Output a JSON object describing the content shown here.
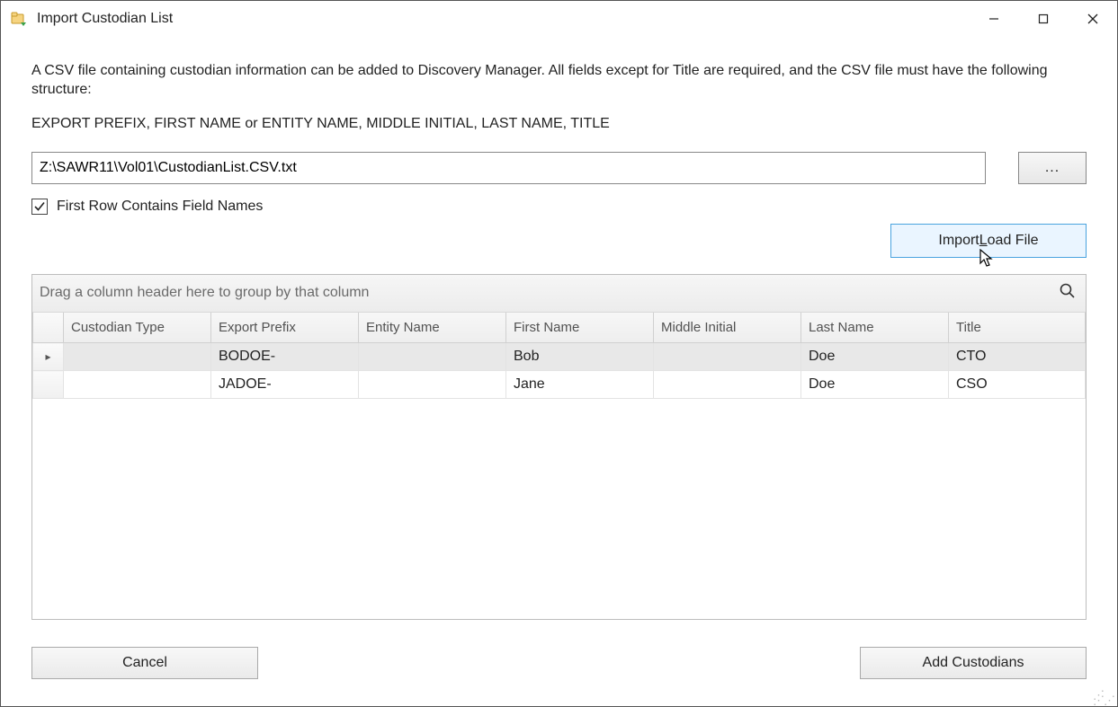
{
  "window": {
    "title": "Import Custodian List"
  },
  "intro": "A CSV file containing custodian information can be added to Discovery Manager. All fields except for Title are required, and the CSV file must have the following structure:",
  "structure_line": "EXPORT PREFIX, FIRST NAME or ENTITY NAME, MIDDLE INITIAL, LAST NAME, TITLE",
  "file_path": {
    "value": "Z:\\SAWR11\\Vol01\\CustodianList.CSV.txt",
    "browse_label": "..."
  },
  "first_row_checkbox": {
    "checked": true,
    "label": "First Row Contains Field Names"
  },
  "import_button": {
    "pre": "Import ",
    "underlined": "L",
    "post": "oad File"
  },
  "grid": {
    "group_hint": "Drag a column header here to group by that column",
    "columns": {
      "indicator": "",
      "custodian_type": "Custodian Type",
      "export_prefix": "Export Prefix",
      "entity_name": "Entity Name",
      "first_name": "First Name",
      "middle_initial": "Middle Initial",
      "last_name": "Last Name",
      "title": "Title"
    },
    "rows": [
      {
        "selected": true,
        "custodian_type": "",
        "export_prefix": "BODOE-",
        "entity_name": "",
        "first_name": "Bob",
        "middle_initial": "",
        "last_name": "Doe",
        "title": "CTO"
      },
      {
        "selected": false,
        "custodian_type": "",
        "export_prefix": "JADOE-",
        "entity_name": "",
        "first_name": "Jane",
        "middle_initial": "",
        "last_name": "Doe",
        "title": "CSO"
      }
    ]
  },
  "footer": {
    "cancel": "Cancel",
    "add": "Add Custodians"
  }
}
